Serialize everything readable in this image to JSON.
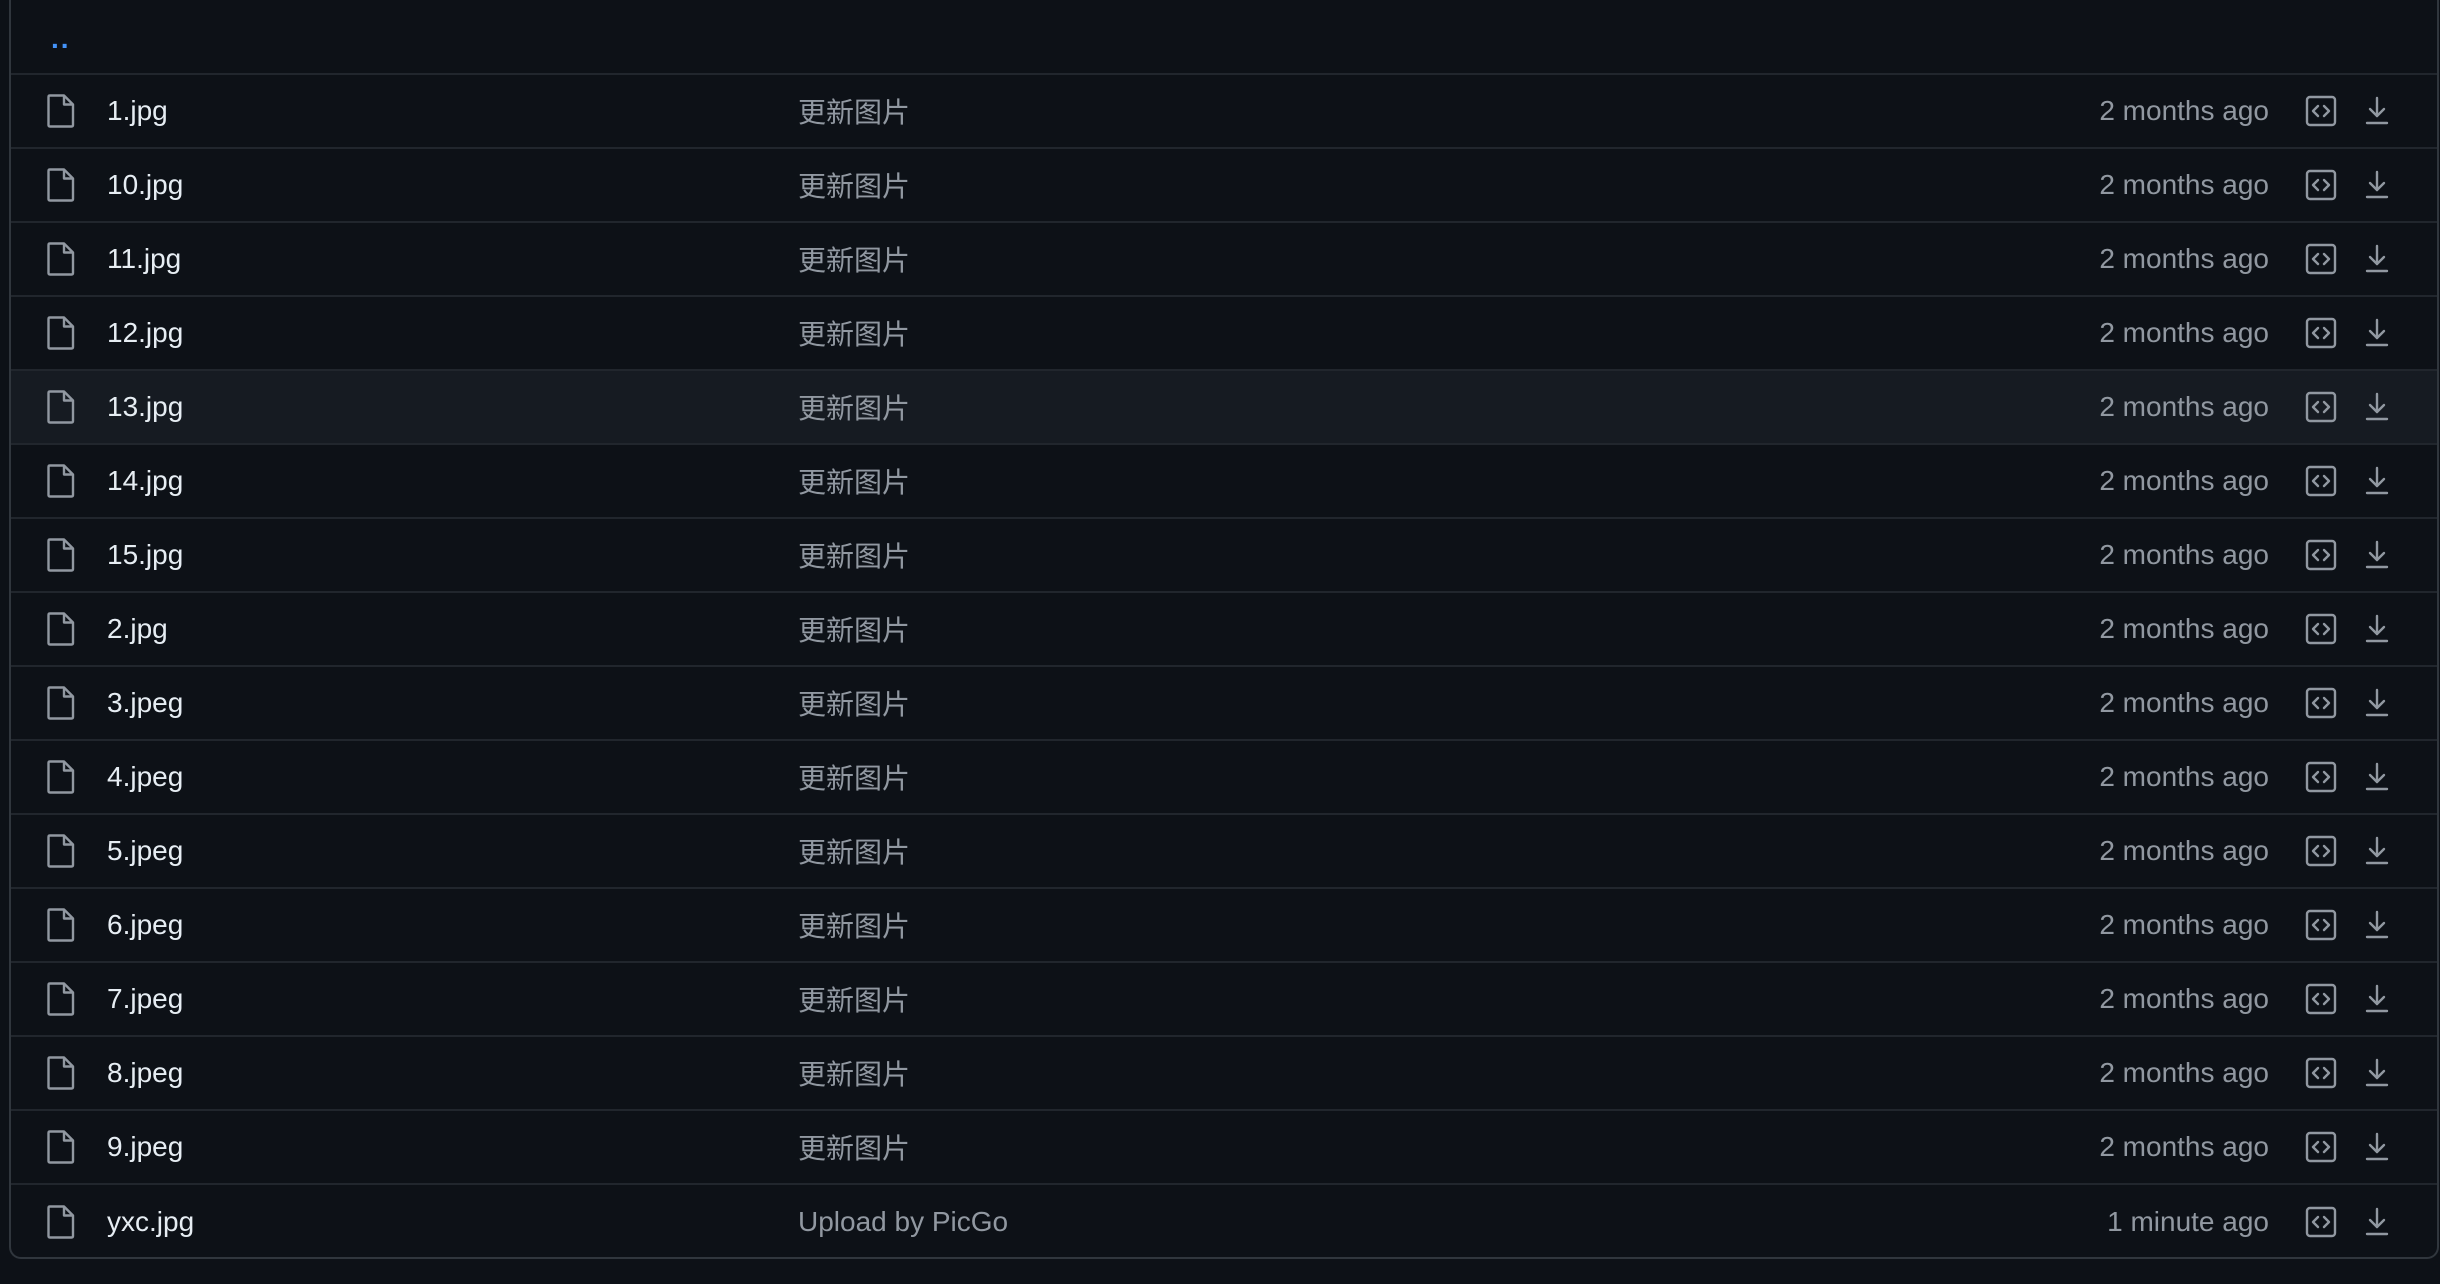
{
  "parent_dir": {
    "label": ".."
  },
  "files": [
    {
      "name": "1.jpg",
      "message": "更新图片",
      "time": "2 months ago"
    },
    {
      "name": "10.jpg",
      "message": "更新图片",
      "time": "2 months ago"
    },
    {
      "name": "11.jpg",
      "message": "更新图片",
      "time": "2 months ago"
    },
    {
      "name": "12.jpg",
      "message": "更新图片",
      "time": "2 months ago"
    },
    {
      "name": "13.jpg",
      "message": "更新图片",
      "time": "2 months ago"
    },
    {
      "name": "14.jpg",
      "message": "更新图片",
      "time": "2 months ago"
    },
    {
      "name": "15.jpg",
      "message": "更新图片",
      "time": "2 months ago"
    },
    {
      "name": "2.jpg",
      "message": "更新图片",
      "time": "2 months ago"
    },
    {
      "name": "3.jpeg",
      "message": "更新图片",
      "time": "2 months ago"
    },
    {
      "name": "4.jpeg",
      "message": "更新图片",
      "time": "2 months ago"
    },
    {
      "name": "5.jpeg",
      "message": "更新图片",
      "time": "2 months ago"
    },
    {
      "name": "6.jpeg",
      "message": "更新图片",
      "time": "2 months ago"
    },
    {
      "name": "7.jpeg",
      "message": "更新图片",
      "time": "2 months ago"
    },
    {
      "name": "8.jpeg",
      "message": "更新图片",
      "time": "2 months ago"
    },
    {
      "name": "9.jpeg",
      "message": "更新图片",
      "time": "2 months ago"
    },
    {
      "name": "yxc.jpg",
      "message": "Upload by PicGo",
      "time": "1 minute ago"
    }
  ],
  "icons": {
    "file": "file-icon",
    "view_code": "code-square-icon",
    "download": "download-icon"
  },
  "colors": {
    "background": "#0d1117",
    "border": "#30363d",
    "row_divider": "#21262d",
    "hover_row": "#161b22",
    "link": "#4493f8",
    "text": "#e6edf3",
    "muted": "#9198a1"
  },
  "hovered_row": 4
}
